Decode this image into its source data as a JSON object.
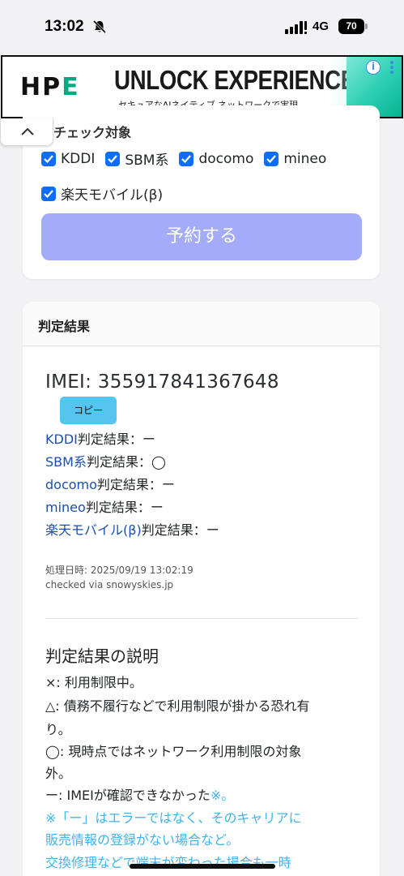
{
  "status_bar": {
    "time": "13:02",
    "network": "4G",
    "battery": "70"
  },
  "ad": {
    "logo_text": "HPE",
    "headline": "UNLOCK EXPERIENCES",
    "subline": "セキュアなAIネイティブ ネットワークで実現",
    "info_label": "i",
    "colors": {
      "accent": "#01a982"
    }
  },
  "check_section": {
    "title": "チェック対象",
    "options": [
      {
        "label": "KDDI",
        "checked": true
      },
      {
        "label": "SBM系",
        "checked": true
      },
      {
        "label": "docomo",
        "checked": true
      },
      {
        "label": "mineo",
        "checked": true
      },
      {
        "label": "楽天モバイル(β)",
        "checked": true
      }
    ],
    "reserve_button": "予約する"
  },
  "result_card": {
    "header": "判定結果",
    "imei": "IMEI: 355917841367648",
    "copy_button": "コピー",
    "results": [
      {
        "carrier": "KDDI",
        "suffix": "判定結果：ー"
      },
      {
        "carrier": "SBM系",
        "suffix": "判定結果：◯"
      },
      {
        "carrier": "docomo",
        "suffix": "判定結果：ー"
      },
      {
        "carrier": "mineo",
        "suffix": "判定結果：ー"
      },
      {
        "carrier": "楽天モバイル(β)",
        "suffix": "判定結果：ー"
      }
    ],
    "processed_at": "処理日時: 2025/09/19 13:02:19",
    "checked_via": "checked via snowyskies.jp",
    "explanation_title": "判定結果の説明",
    "explanation_lines": [
      "×: 利用制限中。",
      "△: 債務不履行などで利用制限が掛かる恐れ有",
      "り。",
      "◯: 現時点ではネットワーク利用制限の対象",
      "外。"
    ],
    "dash_line_text": "ー: IMEIが確認できなかった",
    "dash_line_mark": "※。",
    "notes": [
      "※「ー」はエラーではなく、そのキャリアに",
      "販売情報の登録がない場合など。",
      "交換修理などで端末が変わった場合も一時"
    ]
  }
}
